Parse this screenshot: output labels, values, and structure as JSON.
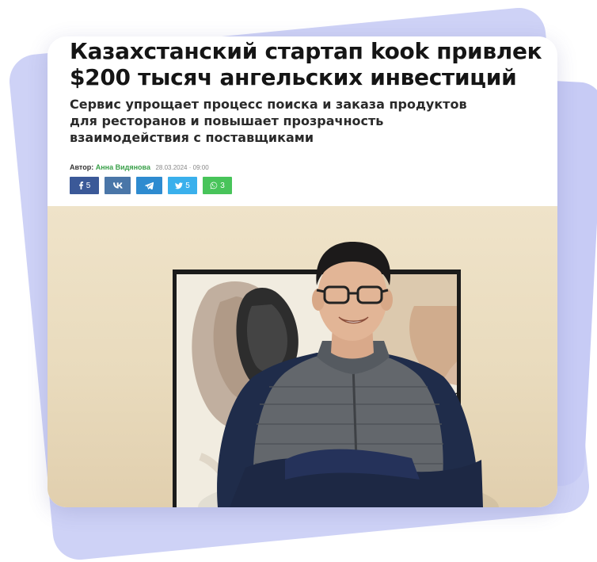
{
  "article": {
    "headline": "Казахстанский стартап kook привлек $200 тысяч ангельских инвестиций",
    "lead": "Сервис упрощает процесс поиска и заказа продуктов для ресторанов и повышает прозрачность взаимодействия с поставщиками",
    "author_label": "Автор:",
    "author_name": "Анна Видянова",
    "date": "28.03.2024 · 09:00"
  },
  "share_buttons": [
    {
      "network": "facebook",
      "icon": "facebook-icon",
      "count": "5",
      "color": "#3b5998"
    },
    {
      "network": "vk",
      "icon": "vk-icon",
      "count": "",
      "color": "#4a76a8"
    },
    {
      "network": "telegram",
      "icon": "telegram-icon",
      "count": "",
      "color": "#2e8bd0"
    },
    {
      "network": "twitter",
      "icon": "twitter-icon",
      "count": "5",
      "color": "#3ab0ec"
    },
    {
      "network": "whatsapp",
      "icon": "whatsapp-icon",
      "count": "3",
      "color": "#48c45a"
    }
  ],
  "colors": {
    "background_shape": "#ced2f6",
    "author_link": "#3aa04a"
  }
}
